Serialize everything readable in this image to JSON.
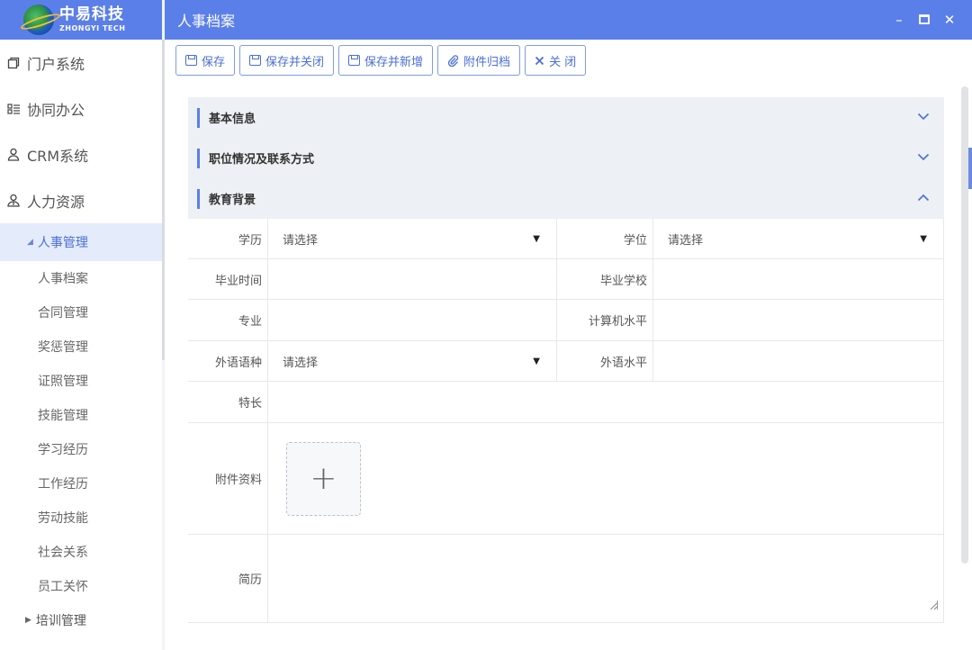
{
  "brand": {
    "name_cn": "中易科技",
    "name_en": "ZHONGYI TECH"
  },
  "sidebar": {
    "menu": [
      {
        "label": "门户系统",
        "icon": "window-icon"
      },
      {
        "label": "协同办公",
        "icon": "list-icon"
      },
      {
        "label": "CRM系统",
        "icon": "user-icon"
      },
      {
        "label": "人力资源",
        "icon": "users-icon"
      }
    ],
    "active_group": "人事管理",
    "leaves": [
      "人事档案",
      "合同管理",
      "奖惩管理",
      "证照管理",
      "技能管理",
      "学习经历",
      "工作经历",
      "劳动技能",
      "社会关系",
      "员工关怀"
    ],
    "collapsed_group": "培训管理"
  },
  "window": {
    "title": "人事档案",
    "controls": {
      "minimize": "–",
      "maximize": "□",
      "close": "✕"
    }
  },
  "toolbar": {
    "save": "保存",
    "save_close": "保存并关闭",
    "save_new": "保存并新增",
    "attach": "附件归档",
    "close": "关 闭"
  },
  "sections": {
    "basic": "基本信息",
    "position": "职位情况及联系方式",
    "education": "教育背景"
  },
  "form": {
    "education": {
      "label": "学历",
      "value": "请选择"
    },
    "degree": {
      "label": "学位",
      "value": "请选择"
    },
    "grad_time": {
      "label": "毕业时间",
      "value": ""
    },
    "school": {
      "label": "毕业学校",
      "value": ""
    },
    "major": {
      "label": "专业",
      "value": ""
    },
    "computer_level": {
      "label": "计算机水平",
      "value": ""
    },
    "language": {
      "label": "外语语种",
      "value": "请选择"
    },
    "language_level": {
      "label": "外语水平",
      "value": ""
    },
    "specialty": {
      "label": "特长",
      "value": ""
    },
    "attachments": {
      "label": "附件资料",
      "add": "+"
    },
    "resume": {
      "label": "简历",
      "value": ""
    }
  }
}
